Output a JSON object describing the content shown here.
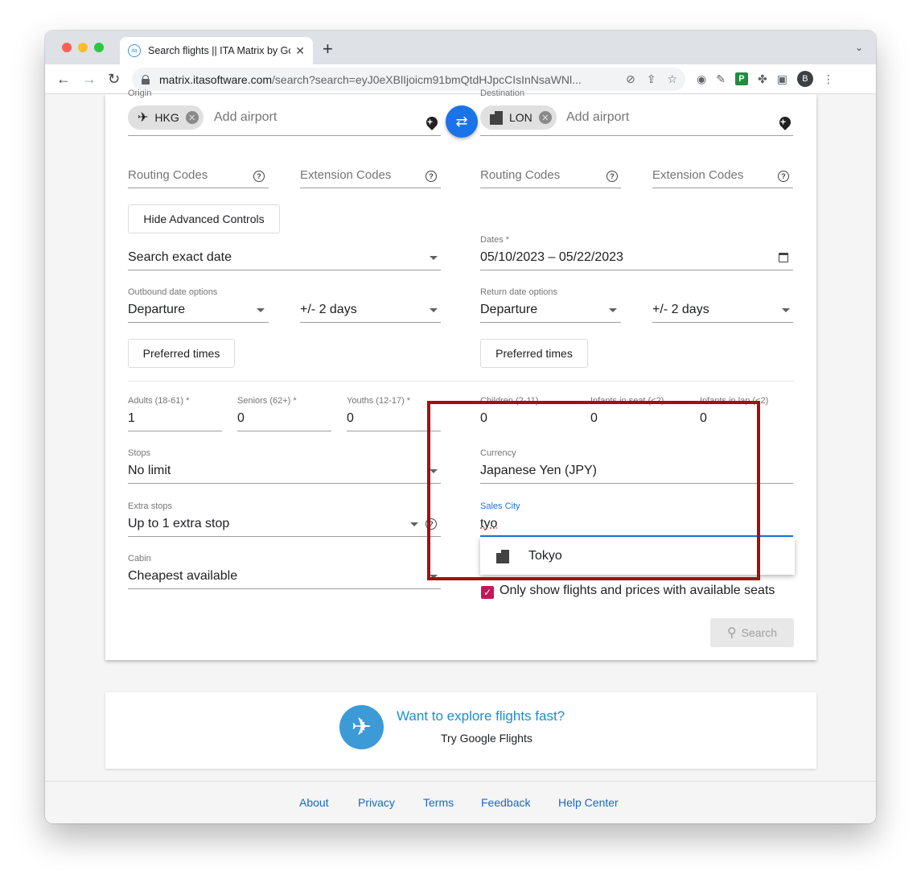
{
  "browser": {
    "tab_title": "Search flights || ITA Matrix by Google",
    "url_host": "matrix.itasoftware.com",
    "url_path": "/search?search=eyJ0eXBlIjoicm91bmQtdHJpcCIsInNsaWNl..."
  },
  "avatar_letter": "B",
  "ext_badge": "P",
  "origin": {
    "label": "Origin",
    "chip": "HKG",
    "placeholder": "Add airport"
  },
  "destination": {
    "label": "Destination",
    "chip": "LON",
    "placeholder": "Add airport"
  },
  "codes": {
    "routing": "Routing Codes",
    "extension": "Extension Codes"
  },
  "advanced_button": "Hide Advanced Controls",
  "date_mode": "Search exact date",
  "dates": {
    "label": "Dates *",
    "value": "05/10/2023 – 05/22/2023"
  },
  "outbound": {
    "label": "Outbound date options",
    "type": "Departure",
    "range": "+/- 2 days",
    "times_button": "Preferred times"
  },
  "return": {
    "label": "Return date options",
    "type": "Departure",
    "range": "+/- 2 days",
    "times_button": "Preferred times"
  },
  "passengers": {
    "adults_label": "Adults (18-61) *",
    "adults": "1",
    "seniors_label": "Seniors (62+) *",
    "seniors": "0",
    "youths_label": "Youths (12-17) *",
    "youths": "0",
    "children_label": "Children (2-11)",
    "children": "0",
    "infants_seat_label": "Infants in seat (<2)",
    "infants_seat": "0",
    "infants_lap_label": "Infants in lap (<2)",
    "infants_lap": "0"
  },
  "stops": {
    "label": "Stops",
    "value": "No limit"
  },
  "extra_stops": {
    "label": "Extra stops",
    "value": "Up to 1 extra stop"
  },
  "cabin": {
    "label": "Cabin",
    "value": "Cheapest available"
  },
  "currency": {
    "label": "Currency",
    "value": "Japanese Yen (JPY)"
  },
  "sales_city": {
    "label": "Sales City",
    "value": "tyo",
    "suggestion": "Tokyo"
  },
  "availability_checkbox": "Only show flights and prices with available seats",
  "search_button": "Search",
  "promo": {
    "title": "Want to explore flights fast?",
    "subtitle": "Try Google Flights"
  },
  "footer": {
    "links": [
      "About",
      "Privacy",
      "Terms",
      "Feedback",
      "Help Center"
    ]
  },
  "colors": {
    "accent": "#1a73e8",
    "highlight": "#a50e0e",
    "checkbox": "#c2185b",
    "link": "#1967d2"
  }
}
